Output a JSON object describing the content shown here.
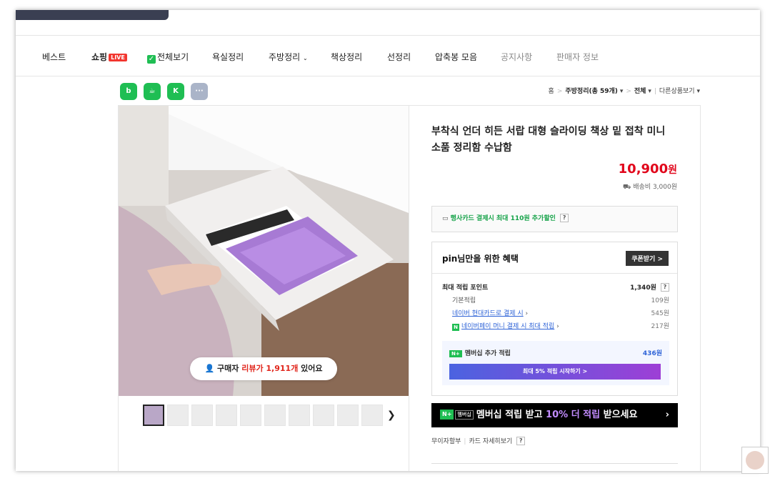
{
  "nav": {
    "items": [
      "베스트",
      "쇼핑",
      "전체보기",
      "욕실정리",
      "주방정리",
      "책상정리",
      "선정리",
      "압축봉 모음",
      "공지사항",
      "판매자 정보"
    ],
    "live_badge": "LIVE"
  },
  "share": [
    "blog",
    "cafe",
    "keep",
    "more"
  ],
  "breadcrumb": {
    "home": "홈",
    "category": "주방정리(총 59개)",
    "filter": "전체",
    "other": "다른상품보기"
  },
  "product": {
    "title": "부착식 언더 히든 서랍 대형 슬라이딩 책상 밑 접착 미니 소품 정리함 수납함",
    "price": "10,900",
    "price_unit": "원",
    "shipping": "배송비 3,000원",
    "review_pill": {
      "prefix": "구매자",
      "highlight": "리뷰가 1,911개",
      "suffix": "있어요"
    }
  },
  "card_benefit": "행사카드 결제시 최대 110원 추가할인",
  "benefits": {
    "heading": "pin님만을 위한 혜택",
    "coupon_button": "쿠폰받기",
    "max_points_label": "최대 적립 포인트",
    "max_points_value": "1,340원",
    "rows": [
      {
        "label": "기본적립",
        "value": "109원"
      },
      {
        "label": "네이버 현대카드로 결제 시",
        "value": "545원"
      },
      {
        "label": "네이버페이 머니 결제 시 최대 적립",
        "value": "217원"
      }
    ],
    "membership_label": "멤버십 추가 적립",
    "membership_value": "436원",
    "membership_button": "최대 5% 적립 시작하기 >"
  },
  "member_banner": {
    "badge": "N+",
    "badge2": "멤버십",
    "text_a": "멤버십 적립 받고 ",
    "text_hl": "10% 더 적립",
    "text_b": " 받으세요"
  },
  "installment": {
    "label": "무이자할부",
    "card": "카드 자세히보기"
  },
  "colors": {
    "price_red": "#e1061b",
    "naver_green": "#1fbe53",
    "link_blue": "#2e63d7"
  }
}
